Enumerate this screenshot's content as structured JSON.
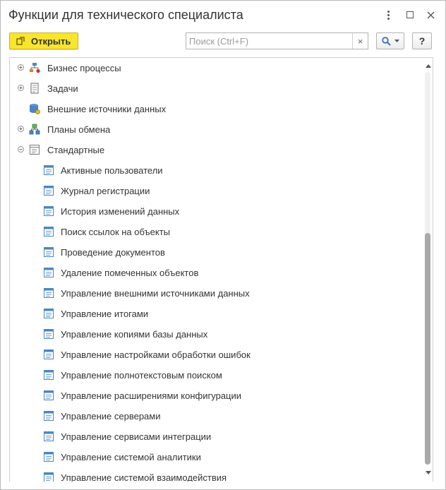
{
  "window": {
    "title": "Функции для технического специалиста"
  },
  "toolbar": {
    "open_label": "Открыть",
    "search_placeholder": "Поиск (Ctrl+F)",
    "search_value": "",
    "clear_label": "×",
    "help_label": "?"
  },
  "tree": {
    "items": [
      {
        "label": "Бизнес процессы",
        "level": 0,
        "expander": "plus",
        "icon": "business-process-icon"
      },
      {
        "label": "Задачи",
        "level": 0,
        "expander": "plus",
        "icon": "tasks-icon"
      },
      {
        "label": "Внешние источники данных",
        "level": 0,
        "expander": "none",
        "icon": "external-data-source-icon"
      },
      {
        "label": "Планы обмена",
        "level": 0,
        "expander": "plus",
        "icon": "exchange-plan-icon"
      },
      {
        "label": "Стандартные",
        "level": 0,
        "expander": "minus",
        "icon": "standard-folder-icon"
      },
      {
        "label": "Активные пользователи",
        "level": 1,
        "expander": "none",
        "icon": "function-form-icon"
      },
      {
        "label": "Журнал регистрации",
        "level": 1,
        "expander": "none",
        "icon": "function-form-icon"
      },
      {
        "label": "История изменений данных",
        "level": 1,
        "expander": "none",
        "icon": "function-form-icon"
      },
      {
        "label": "Поиск ссылок на объекты",
        "level": 1,
        "expander": "none",
        "icon": "function-form-icon"
      },
      {
        "label": "Проведение документов",
        "level": 1,
        "expander": "none",
        "icon": "function-form-icon"
      },
      {
        "label": "Удаление помеченных объектов",
        "level": 1,
        "expander": "none",
        "icon": "function-form-icon"
      },
      {
        "label": "Управление внешними источниками данных",
        "level": 1,
        "expander": "none",
        "icon": "function-form-icon"
      },
      {
        "label": "Управление итогами",
        "level": 1,
        "expander": "none",
        "icon": "function-form-icon"
      },
      {
        "label": "Управление копиями базы данных",
        "level": 1,
        "expander": "none",
        "icon": "function-form-icon"
      },
      {
        "label": "Управление настройками обработки ошибок",
        "level": 1,
        "expander": "none",
        "icon": "function-form-icon"
      },
      {
        "label": "Управление полнотекстовым поиском",
        "level": 1,
        "expander": "none",
        "icon": "function-form-icon"
      },
      {
        "label": "Управление расширениями конфигурации",
        "level": 1,
        "expander": "none",
        "icon": "function-form-icon"
      },
      {
        "label": "Управление серверами",
        "level": 1,
        "expander": "none",
        "icon": "function-form-icon"
      },
      {
        "label": "Управление сервисами интеграции",
        "level": 1,
        "expander": "none",
        "icon": "function-form-icon"
      },
      {
        "label": "Управление системой аналитики",
        "level": 1,
        "expander": "none",
        "icon": "function-form-icon"
      },
      {
        "label": "Управление системой взаимодействия",
        "level": 1,
        "expander": "none",
        "icon": "function-form-icon"
      }
    ]
  },
  "scroll": {
    "thumb_start": 0.41,
    "thumb_end": 1.0
  },
  "colors": {
    "open_button": "#f8e52d",
    "item_icon": "#4a86c5",
    "text": "#333333"
  }
}
